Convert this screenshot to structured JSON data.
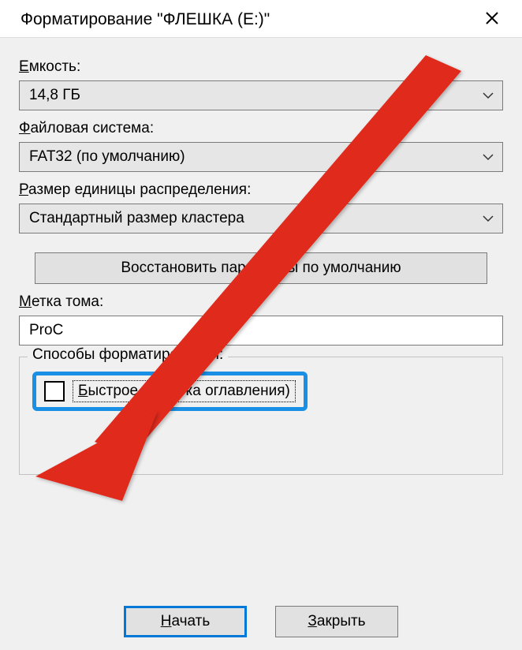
{
  "titlebar": {
    "title": "Форматирование \"ФЛЕШКА (E:)\""
  },
  "labels": {
    "capacity": "Емкость:",
    "filesystem": "Файловая система:",
    "allocation": "Размер единицы распределения:",
    "restore_defaults": "Восстановить параметры по умолчанию",
    "volume_label": "Метка тома:",
    "format_options": "Способы форматирования:",
    "quick_format": "Быстрое (очистка оглавления)"
  },
  "values": {
    "capacity": "14,8 ГБ",
    "filesystem": "FAT32 (по умолчанию)",
    "allocation": "Стандартный размер кластера",
    "volume_label_prefix": "ProC"
  },
  "buttons": {
    "start": "Начать",
    "close": "Закрыть"
  },
  "annotation": {
    "arrow_color": "#e02b1f"
  }
}
